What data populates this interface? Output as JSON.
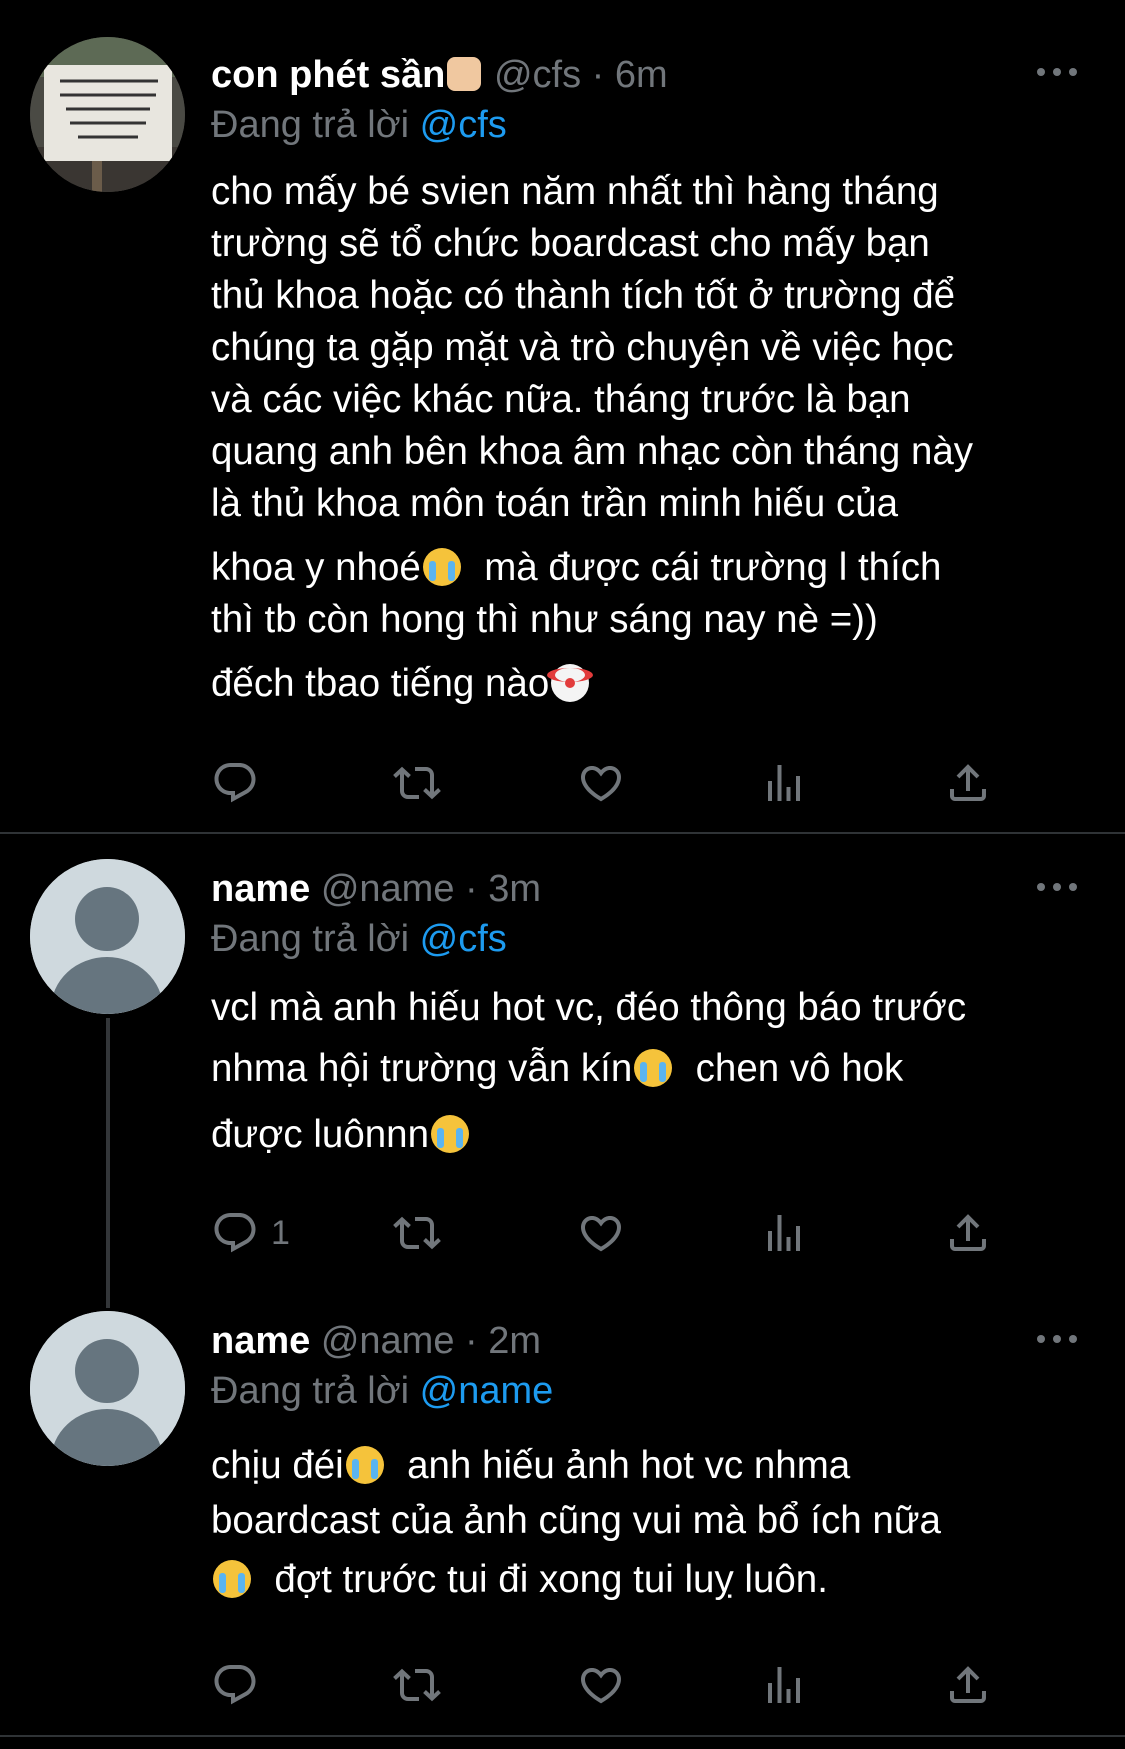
{
  "tweets": [
    {
      "display_name": "con phét sần",
      "handle": "@cfs",
      "time": "6m",
      "reply_prefix": "Đang trả lời",
      "reply_to": "@cfs",
      "avatar_sign_text": "LÀM NGƯỜI PHẢI CÓ Ý THỨC RÁC NHÀ AI, ĐỂ NHÀ ĐÓ MUỐN ĐƯỢC PHỤC VỤ PHẢI BỎ TIỀN",
      "lines": [
        "cho mấy bé svien năm nhất thì hàng tháng",
        "trường sẽ tổ chức boardcast cho mấy bạn",
        "thủ khoa hoặc có thành tích tốt ở trường để",
        "chúng ta gặp mặt và trò chuyện về việc học",
        "và các việc khác nữa. tháng trước là bạn",
        "quang anh bên khoa âm nhạc còn tháng này",
        "là thủ khoa môn toán trần minh hiếu của"
      ],
      "line8_a": "khoa y nhoé",
      "line8_b": "mà được cái trường l thích",
      "line9": "thì tb còn hong thì như sáng nay nè =))",
      "line10": "đếch tbao tiếng nào",
      "reply_count": ""
    },
    {
      "display_name": "name",
      "handle": "@name",
      "time": "3m",
      "reply_prefix": "Đang trả lời",
      "reply_to": "@cfs",
      "line1": "vcl mà anh hiếu hot vc, đéo thông báo trước",
      "line2_a": "nhma hội trường vẫn kín",
      "line2_b": "chen vô hok",
      "line3": "được luônnn",
      "reply_count": "1"
    },
    {
      "display_name": "name",
      "handle": "@name",
      "time": "2m",
      "reply_prefix": "Đang trả lời",
      "reply_to": "@name",
      "line1_a": "chịu đéi",
      "line1_b": "anh hiếu ảnh hot vc nhma",
      "line2": "boardcast của ảnh cũng vui mà bổ ích nữa",
      "line3": "đợt trước tui đi xong tui luỵ luôn.",
      "reply_count": ""
    }
  ],
  "separator": " · ",
  "icons": {
    "reply": "reply-icon",
    "retweet": "retweet-icon",
    "like": "heart-icon",
    "views": "views-icon",
    "share": "share-icon",
    "more": "more-icon"
  },
  "colors": {
    "background": "#000000",
    "text": "#ffffff",
    "secondary": "#71767b",
    "link": "#1d9bf0",
    "divider": "#2f3336"
  }
}
